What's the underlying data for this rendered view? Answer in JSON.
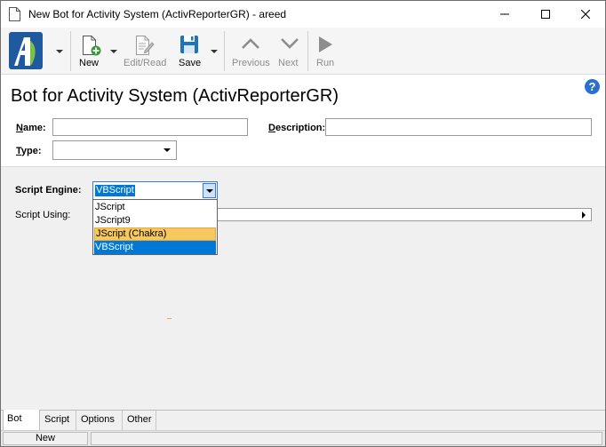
{
  "window": {
    "title": "New Bot for Activity System (ActivReporterGR) - areed"
  },
  "toolbar": {
    "buttons": [
      {
        "label": "New",
        "icon": "new-document-icon",
        "enabled": true
      },
      {
        "label": "Edit/Read",
        "icon": "edit-document-icon",
        "enabled": false
      },
      {
        "label": "Save",
        "icon": "floppy-disk-icon",
        "enabled": true
      },
      {
        "label": "Previous",
        "icon": "chevron-up-icon",
        "enabled": false
      },
      {
        "label": "Next",
        "icon": "chevron-down-icon",
        "enabled": false
      },
      {
        "label": "Run",
        "icon": "play-icon",
        "enabled": false
      }
    ]
  },
  "header": {
    "title": "Bot for Activity System (ActivReporterGR)",
    "help_glyph": "?",
    "name_label": "Name:",
    "name_value": "",
    "description_label": "Description:",
    "description_value": "",
    "type_label": "Type:",
    "type_value": ""
  },
  "script": {
    "engine_label": "Script Engine:",
    "engine_value": "VBScript",
    "using_label": "Script Using:",
    "options": [
      "JScript",
      "JScript9",
      "JScript (Chakra)",
      "VBScript"
    ],
    "hovered_option": "JScript (Chakra)",
    "selected_option": "VBScript"
  },
  "tabs": [
    "Bot",
    "Script",
    "Options",
    "Other"
  ],
  "active_tab": "Bot",
  "status": {
    "mode": "New"
  },
  "colors": {
    "selection_blue": "#0078d7",
    "hover_orange": "#f6c85f",
    "help_blue": "#2b6fcf",
    "save_blue": "#1e73be",
    "new_green": "#3a9a3a"
  }
}
